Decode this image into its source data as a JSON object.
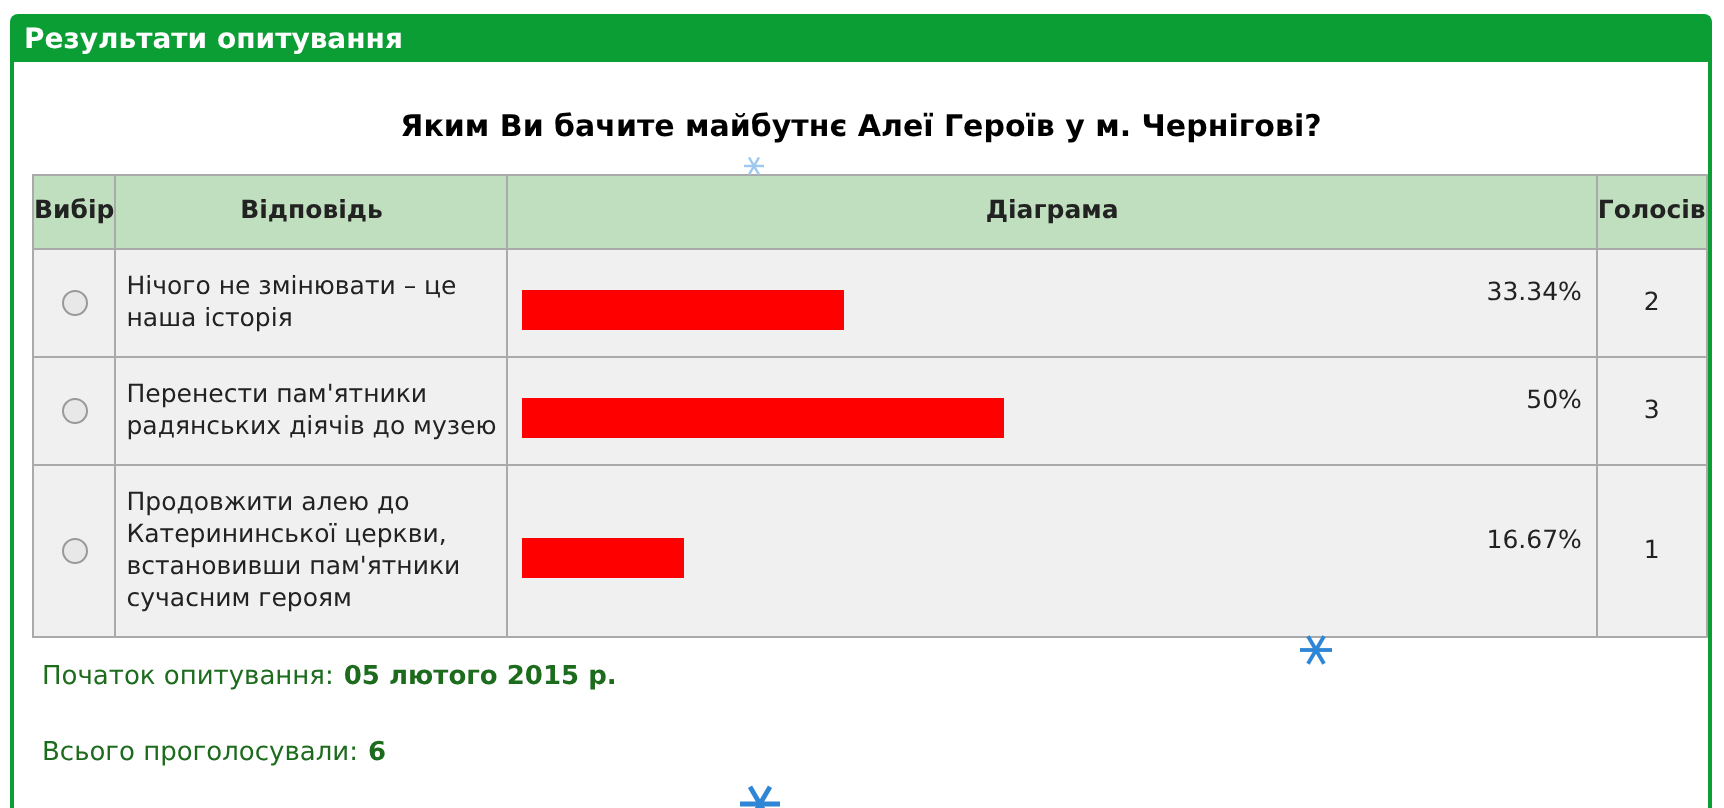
{
  "panel": {
    "title": "Результати опитування"
  },
  "question": "Яким Ви бачите майбутнє Алеї Героїв у м. Чернігові?",
  "table": {
    "columns": [
      "Вибір",
      "Відповідь",
      "Діаграма",
      "Голосів"
    ],
    "rows": [
      {
        "answer": "Нічого не змінювати – це наша історія",
        "selected": false,
        "percent": "33.34%",
        "votes": "2"
      },
      {
        "answer": "Перенести пам'ятники радянських діячів до музею",
        "selected": false,
        "percent": "50%",
        "votes": "3"
      },
      {
        "answer": "Продовжити алею до Катерининської церкви, встановивши пам'ятники сучасним героям",
        "selected": false,
        "percent": "16.67%",
        "votes": "1"
      }
    ]
  },
  "start": {
    "label": "Початок опитування:",
    "value": "05 лютого 2015 р."
  },
  "total": {
    "label": "Всього проголосували:",
    "value": "6"
  }
}
